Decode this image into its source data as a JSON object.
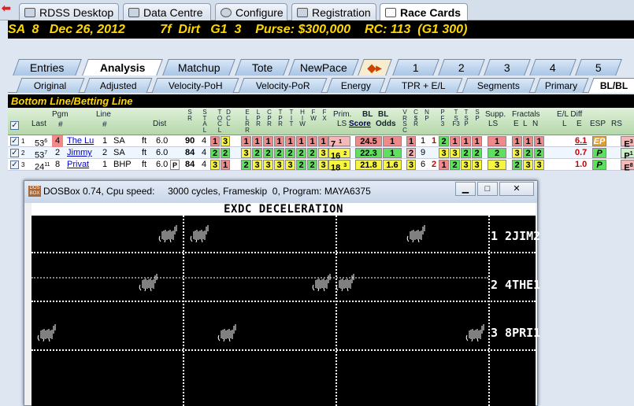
{
  "app_tabs": [
    {
      "label": "RDSS Desktop",
      "icon": "horse-icon"
    },
    {
      "label": "Data Centre",
      "icon": "data-icon"
    },
    {
      "label": "Configure",
      "icon": "gear-icon"
    },
    {
      "label": "Registration",
      "icon": "registration-icon"
    },
    {
      "label": "Race Cards",
      "icon": "racecard-icon"
    }
  ],
  "race_header": "SA  8   Dec 26, 2012          7f  Dirt   G1  3    Purse: $300,000    RC: 113  (G1 300)",
  "main_tabs": [
    "Entries",
    "Analysis",
    "Matchup",
    "Tote",
    "NewPace",
    "1",
    "2",
    "3",
    "4",
    "5"
  ],
  "sub_tabs": [
    "Original",
    "Adjusted",
    "Velocity-PoH",
    "Velocity-PoR",
    "Energy",
    "TPR + E/L",
    "Segments",
    "Primary",
    "BL/BL"
  ],
  "section_title": "Bottom Line/Betting Line",
  "headers": {
    "last": "Last",
    "pgm": "Pgm",
    "pgm_hash": "#",
    "line": "Line",
    "line_hash": "#",
    "dist": "Dist",
    "sral": [
      "S",
      "R",
      "A",
      "L"
    ],
    "btl": [
      "B",
      "T",
      "L"
    ],
    "docl": [
      "T",
      "O",
      "C",
      "L"
    ],
    "dcl": [
      "D",
      "C",
      "L"
    ],
    "el": [
      "E",
      "L",
      "R"
    ],
    "lp": [
      "L",
      "P",
      "R"
    ],
    "cp": [
      "C",
      "P",
      "R"
    ],
    "tt": [
      "T",
      "T",
      "R"
    ],
    "hi": [
      "H",
      "I",
      "W"
    ],
    "fw": [
      "F",
      "W"
    ],
    "fx": [
      "F",
      "X"
    ],
    "prim": "Prim.",
    "prim_ls": "LS",
    "bl": "BL",
    "bl2": "BL",
    "score": "Score",
    "odds": "Odds",
    "vds": [
      "V",
      "D",
      "S"
    ],
    "c": [
      "C",
      "$",
      "R"
    ],
    "np": [
      "N",
      "P"
    ],
    "pt": [
      "P",
      "F",
      "3"
    ],
    "tt3": [
      "T",
      "S",
      "F3"
    ],
    "ts": [
      "T",
      "S",
      "P"
    ],
    "sp": [
      "S",
      "P"
    ],
    "supp": "Supp.",
    "supp_ls": "LS",
    "fractals": "Fractals",
    "fr_e": "E",
    "fr_l": "L",
    "fr_n": "N",
    "eldiff": "E/L Diff",
    "el_l": "L",
    "el_e": "E",
    "esp": "ESP",
    "rs": "RS"
  },
  "rows": [
    {
      "n": "1",
      "last": "53",
      "last_sup": "6",
      "pgm": "4",
      "name": "The Lu",
      "line": "1",
      "track": "SA",
      "surf": "ft",
      "dist": "6.0",
      "post": "",
      "sral": "90",
      "b": "4",
      "t1": "1",
      "t2": "3",
      "els": [
        "1",
        "1",
        "1",
        "1",
        "1",
        "1",
        "1",
        "1"
      ],
      "prim": "7",
      "prim_sup": "1",
      "score": "24.5",
      "odds": "1",
      "v": "1",
      "c": "1",
      "np": "1",
      "p": [
        "2",
        "1",
        "1",
        "1"
      ],
      "supp": "1",
      "fr": [
        "1",
        "1",
        "1"
      ],
      "diff": "6.1",
      "esp": "EP",
      "rs": "E",
      "rs_sup": "3"
    },
    {
      "n": "2",
      "last": "53",
      "last_sup": "7",
      "pgm": "2",
      "name": "Jimmy",
      "line": "2",
      "track": "SA",
      "surf": "ft",
      "dist": "6.0",
      "post": "",
      "sral": "84",
      "b": "4",
      "t1": "2",
      "t2": "2",
      "els": [
        "3",
        "2",
        "2",
        "2",
        "2",
        "2",
        "2",
        "3"
      ],
      "prim": "16",
      "prim_sup": "2",
      "score": "22.3",
      "odds": "1",
      "v": "2",
      "c": "9",
      "np": "",
      "p": [
        "3",
        "3",
        "2",
        "2"
      ],
      "supp": "2",
      "fr": [
        "3",
        "2",
        "2"
      ],
      "diff": "0.7",
      "esp": "P",
      "rs": "P",
      "rs_sup": "1"
    },
    {
      "n": "3",
      "last": "24",
      "last_sup": "11",
      "pgm": "8",
      "name": "Privat",
      "line": "1",
      "track": "BHP",
      "surf": "ft",
      "dist": "6.0",
      "post": "P",
      "sral": "84",
      "b": "4",
      "t1": "3",
      "t2": "1",
      "els": [
        "2",
        "3",
        "3",
        "3",
        "3",
        "2",
        "2",
        "3"
      ],
      "prim": "18",
      "prim_sup": "3",
      "score": "21.8",
      "odds": "1.6",
      "v": "3",
      "c": "6",
      "np": "2",
      "p": [
        "1",
        "2",
        "3",
        "3"
      ],
      "supp": "3",
      "fr": [
        "2",
        "3",
        "3"
      ],
      "diff": "1.0",
      "esp": "P",
      "rs": "E",
      "rs_sup": "8"
    }
  ],
  "dosbox": {
    "title": "DOSBox 0.74, Cpu speed:     3000 cycles, Frameskip  0, Program: MAYA6375",
    "screen_title": "EXDC DECELERATION",
    "lanes": [
      "1 2JIM2",
      "2 4THE1",
      "3 8PRI1"
    ]
  }
}
